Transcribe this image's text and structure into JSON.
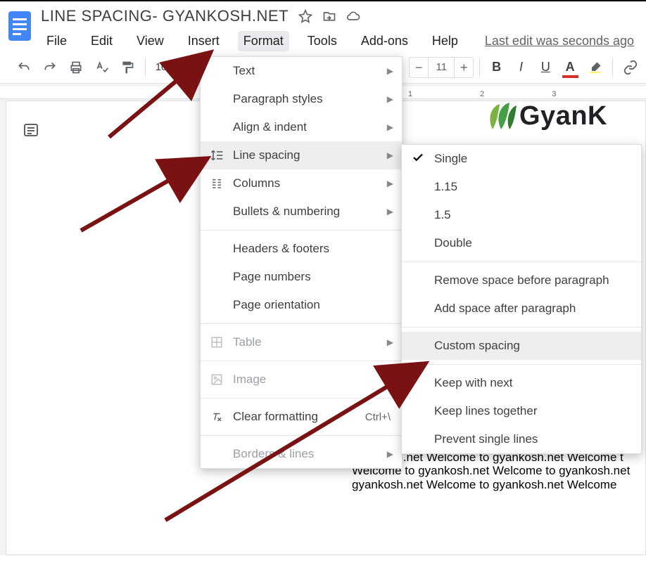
{
  "doc_title": "LINE SPACING- GYANKOSH.NET",
  "menubar": {
    "file": "File",
    "edit": "Edit",
    "view": "View",
    "insert": "Insert",
    "format": "Format",
    "tools": "Tools",
    "addons": "Add-ons",
    "help": "Help",
    "last_edit": "Last edit was seconds ago"
  },
  "toolbar": {
    "zoom": "100%",
    "fontsize": "11"
  },
  "format_menu": {
    "text": "Text",
    "paragraph_styles": "Paragraph styles",
    "align_indent": "Align & indent",
    "line_spacing": "Line spacing",
    "columns": "Columns",
    "bullets_numbering": "Bullets & numbering",
    "headers_footers": "Headers & footers",
    "page_numbers": "Page numbers",
    "page_orientation": "Page orientation",
    "table": "Table",
    "image": "Image",
    "clear_formatting": "Clear formatting",
    "clear_formatting_shortcut": "Ctrl+\\",
    "borders_lines": "Borders & lines"
  },
  "line_spacing_menu": {
    "single": "Single",
    "v115": "1.15",
    "v15": "1.5",
    "double": "Double",
    "remove_before": "Remove space before paragraph",
    "add_after": "Add space after paragraph",
    "custom": "Custom spacing",
    "keep_next": "Keep with next",
    "keep_together": "Keep lines together",
    "prevent_single": "Prevent single lines"
  },
  "brand_text": "GyanK",
  "ruler": {
    "t1": "1",
    "t2": "2",
    "t3": "3"
  },
  "body_text": "e to gyankosh.net Welcome to gyankosh.net gyankosh.net Welcome to gyankosh.net Welcome t Welcome to gyankosh.net Welcome to gyankosh.net gyankosh.net Welcome to gyankosh.net Welcome t Welcome to gyankosh.net Welcome to gyankosh.net gyankosh.net Welcome to gyankosh.net Welcome"
}
